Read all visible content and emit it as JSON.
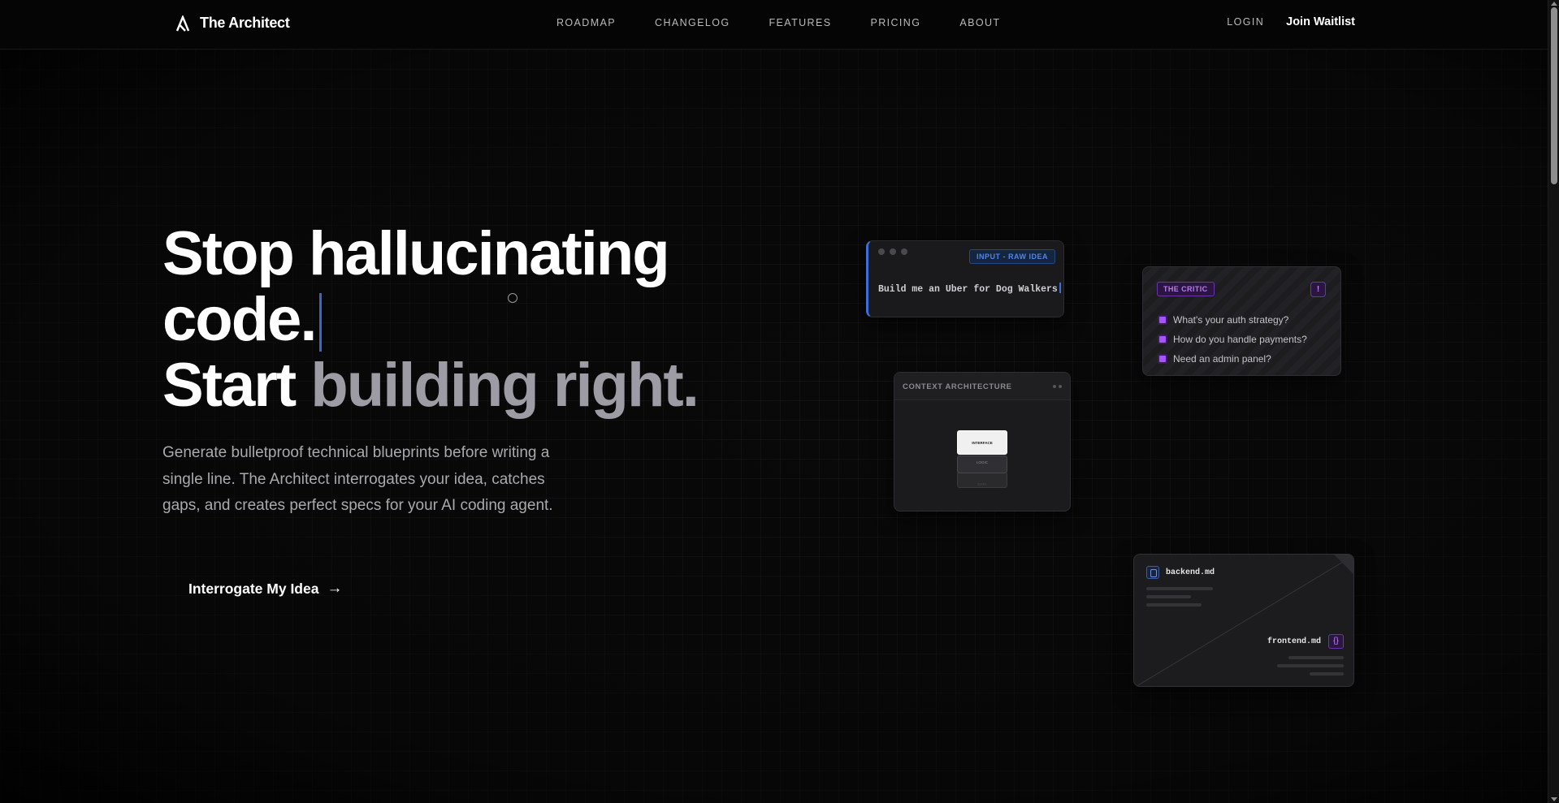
{
  "nav": {
    "brand": "The Architect",
    "links": [
      "ROADMAP",
      "CHANGELOG",
      "FEATURES",
      "PRICING",
      "ABOUT"
    ],
    "login": "LOGIN",
    "join": "Join Waitlist"
  },
  "hero": {
    "line1": "Stop hallucinating",
    "line2": "code.",
    "line3_start": "Start ",
    "line3_accent": "building right.",
    "subtitle": "Generate bulletproof technical blueprints before writing a single line. The Architect interrogates your idea, catches gaps, and creates perfect specs for your AI coding agent.",
    "cta": "Interrogate My Idea",
    "cta_arrow": "→"
  },
  "input_card": {
    "tag": "INPUT - RAW IDEA",
    "text": "Build me an Uber for Dog Walkers"
  },
  "critic_card": {
    "tag": "THE CRITIC",
    "badge": "!",
    "questions": [
      "What's your auth strategy?",
      "How do you handle payments?",
      "Need an admin panel?"
    ]
  },
  "context_card": {
    "title": "CONTEXT ARCHITECTURE",
    "layers": [
      "INTERFACE",
      "LOGIC",
      "DATA"
    ]
  },
  "files_card": {
    "backend": "backend.md",
    "frontend": "frontend.md",
    "frontend_icon": "{}"
  },
  "colors": {
    "background": "#090909",
    "accent_blue": "#3d6fd6",
    "accent_purple": "#a855f7",
    "headline_accent": "#9d9ca4"
  }
}
